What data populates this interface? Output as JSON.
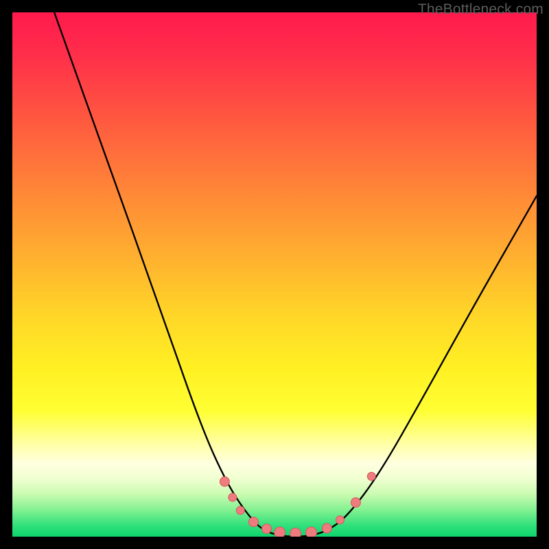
{
  "watermark": "TheBottleneck.com",
  "chart_data": {
    "type": "line",
    "title": "",
    "xlabel": "",
    "ylabel": "",
    "xlim": [
      0,
      100
    ],
    "ylim": [
      0,
      100
    ],
    "colors": {
      "curve": "#000000",
      "marker_fill": "#ee7b7e",
      "marker_stroke": "#d45a5e"
    },
    "curve": [
      {
        "x": 8,
        "y": 100
      },
      {
        "x": 18,
        "y": 72
      },
      {
        "x": 28,
        "y": 44
      },
      {
        "x": 36,
        "y": 21
      },
      {
        "x": 41,
        "y": 10
      },
      {
        "x": 45,
        "y": 4
      },
      {
        "x": 48,
        "y": 1
      },
      {
        "x": 52,
        "y": 0
      },
      {
        "x": 56,
        "y": 0
      },
      {
        "x": 60,
        "y": 1
      },
      {
        "x": 64,
        "y": 4
      },
      {
        "x": 70,
        "y": 12
      },
      {
        "x": 78,
        "y": 26
      },
      {
        "x": 88,
        "y": 44
      },
      {
        "x": 100,
        "y": 65
      }
    ],
    "markers": [
      {
        "x": 40.5,
        "y": 10.5,
        "r": 7
      },
      {
        "x": 42.0,
        "y": 7.5,
        "r": 6
      },
      {
        "x": 43.5,
        "y": 5.0,
        "r": 6
      },
      {
        "x": 46.0,
        "y": 2.8,
        "r": 7
      },
      {
        "x": 48.5,
        "y": 1.5,
        "r": 7
      },
      {
        "x": 51.0,
        "y": 0.8,
        "r": 8
      },
      {
        "x": 54.0,
        "y": 0.6,
        "r": 8
      },
      {
        "x": 57.0,
        "y": 0.8,
        "r": 8
      },
      {
        "x": 60.0,
        "y": 1.6,
        "r": 7
      },
      {
        "x": 62.5,
        "y": 3.2,
        "r": 6
      },
      {
        "x": 65.5,
        "y": 6.5,
        "r": 7
      },
      {
        "x": 68.5,
        "y": 11.5,
        "r": 6
      }
    ]
  }
}
